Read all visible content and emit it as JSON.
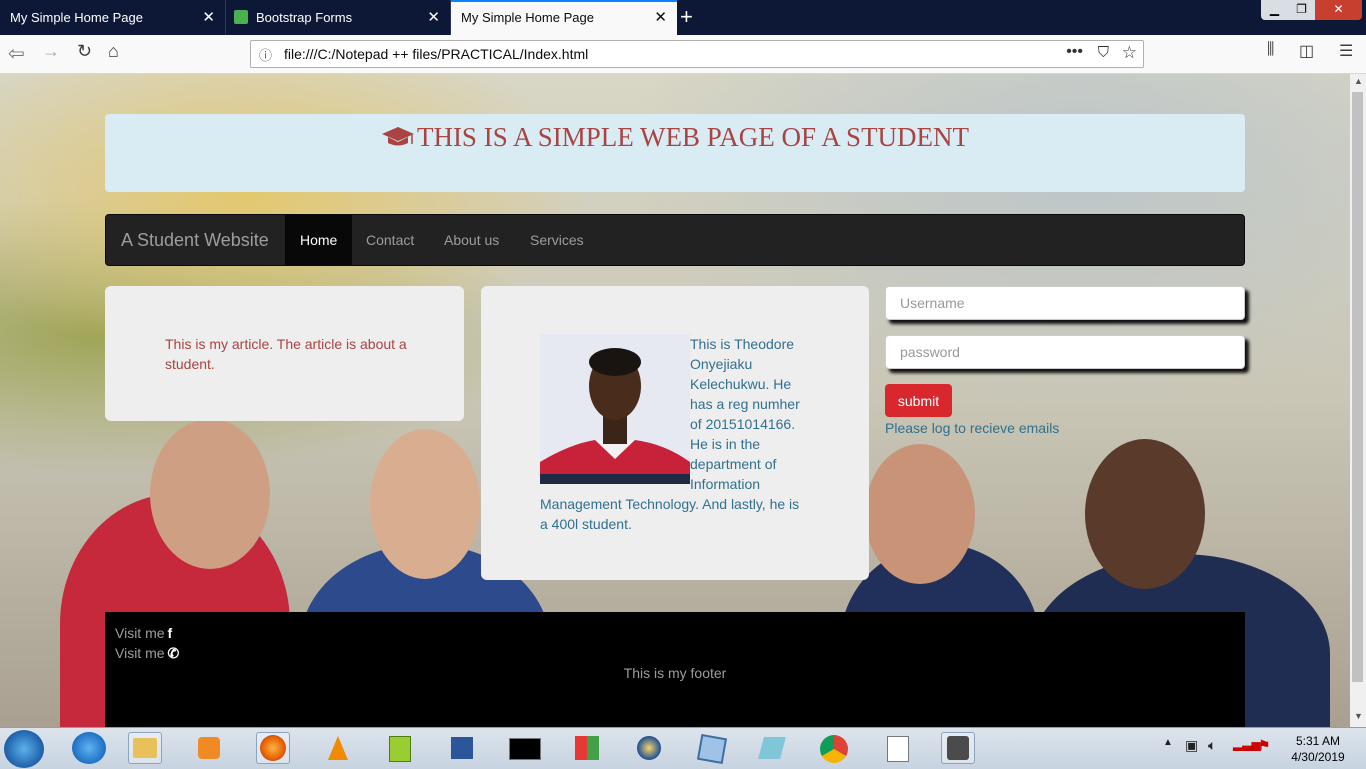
{
  "browser": {
    "tabs": [
      {
        "title": "My Simple Home Page"
      },
      {
        "title": "Bootstrap Forms"
      },
      {
        "title": "My Simple Home Page"
      }
    ],
    "url": "file:///C:/Notepad ++ files/PRACTICAL/Index.html"
  },
  "page": {
    "heading": "THIS IS A SIMPLE WEB PAGE OF A STUDENT",
    "nav": {
      "brand": "A Student Website",
      "links": [
        "Home",
        "Contact",
        "About us",
        "Services"
      ],
      "active": "Home"
    },
    "article": "This is my article. The article is about a student.",
    "bio": "This is Theodore Onyejiaku Kelechukwu. He has a reg numher of 20151014166. He is in the department of Information Management Technology. And lastly, he is a 400l student.",
    "form": {
      "username_placeholder": "Username",
      "password_placeholder": "password",
      "submit_label": "submit",
      "notice": "Please log to recieve emails"
    },
    "footer": {
      "visit_facebook": "Visit me",
      "visit_whatsapp": "Visit me",
      "text": "This is my footer"
    }
  },
  "taskbar": {
    "time": "5:31 AM",
    "date": "4/30/2019"
  },
  "colors": {
    "heading": "#a94442",
    "jumbotron_bg": "#d9ecf4",
    "navbar_bg": "#222222",
    "info_text": "#31708f",
    "submit_bg": "#d9272e"
  }
}
